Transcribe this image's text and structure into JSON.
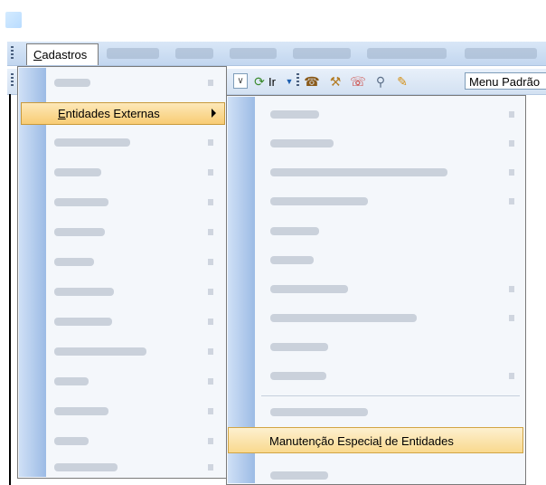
{
  "menubar": {
    "open_menu": {
      "label_prefix": "",
      "label_mnemonic": "C",
      "label_rest": "adastros"
    }
  },
  "toolbar": {
    "go_label": "Ir",
    "profile_combo_value": "Menu Padrão"
  },
  "dropdown": {
    "selected_item": {
      "label_mnemonic": "E",
      "label_rest": "ntidades Externas"
    }
  },
  "submenu": {
    "highlighted_item": {
      "label_before": "Manutenção Especia",
      "label_mnemonic": "l",
      "label_after": " de Entidades"
    }
  },
  "icons": [
    "app-icon",
    "refresh-icon",
    "filter-icon",
    "user-phone-icon",
    "tools-icon",
    "phone-icon",
    "search-icon",
    "pencil-icon",
    "submenu-arrow-icon"
  ]
}
